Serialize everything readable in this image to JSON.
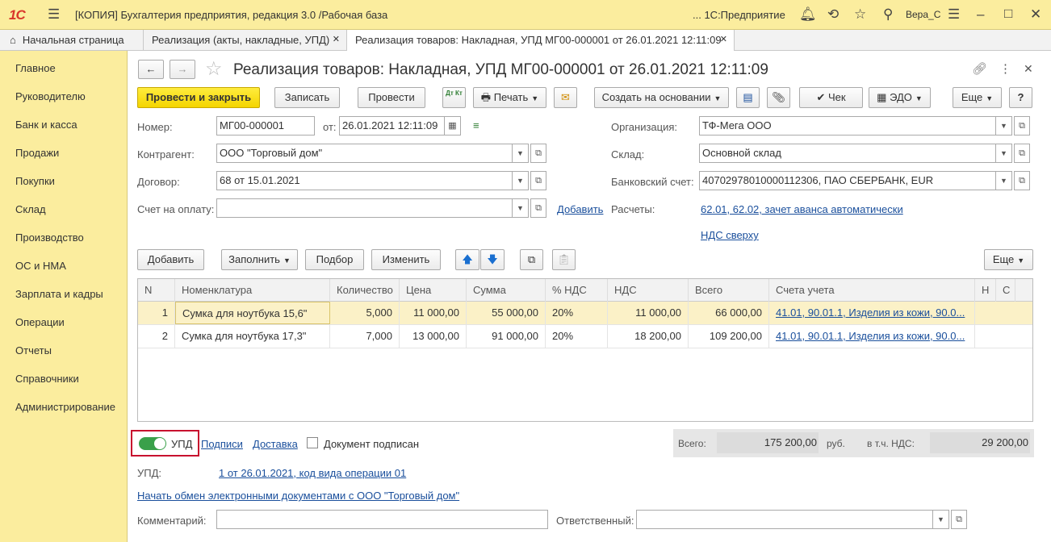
{
  "titlebar": {
    "logo": "1С",
    "title": "[КОПИЯ] Бухгалтерия предприятия, редакция 3.0 /Рабочая база",
    "enterprise": "... 1С:Предприятие",
    "user": "Вера_С"
  },
  "tabs": [
    {
      "label": "Начальная страница"
    },
    {
      "label": "Реализация (акты, накладные, УПД)"
    },
    {
      "label": "Реализация товаров: Накладная, УПД МГ00-000001 от 26.01.2021 12:11:09"
    }
  ],
  "sidebar": {
    "items": [
      "Главное",
      "Руководителю",
      "Банк и касса",
      "Продажи",
      "Покупки",
      "Склад",
      "Производство",
      "ОС и НМА",
      "Зарплата и кадры",
      "Операции",
      "Отчеты",
      "Справочники",
      "Администрирование"
    ]
  },
  "doc": {
    "title": "Реализация товаров: Накладная, УПД МГ00-000001 от 26.01.2021 12:11:09"
  },
  "toolbar": {
    "post_close": "Провести и закрыть",
    "save": "Записать",
    "post": "Провести",
    "dtkt": "Дт Кт",
    "print": "Печать",
    "create_based": "Создать на основании",
    "receipt": "Чек",
    "edo": "ЭДО",
    "more": "Еще",
    "help": "?"
  },
  "form": {
    "number_label": "Номер:",
    "number": "МГ00-000001",
    "date_label": "от:",
    "date": "26.01.2021 12:11:09",
    "org_label": "Организация:",
    "org": "ТФ-Мега ООО",
    "counterparty_label": "Контрагент:",
    "counterparty": "ООО \"Торговый дом\"",
    "warehouse_label": "Склад:",
    "warehouse": "Основной склад",
    "contract_label": "Договор:",
    "contract": "68 от 15.01.2021",
    "bank_label": "Банковский счет:",
    "bank": "40702978010000112306, ПАО СБЕРБАНК, EUR",
    "invoice_label": "Счет на оплату:",
    "invoice": "",
    "add_link": "Добавить",
    "settlements_label": "Расчеты:",
    "settlements_link": "62.01, 62.02, зачет аванса автоматически",
    "vat_link": "НДС сверху"
  },
  "table_toolbar": {
    "add": "Добавить",
    "fill": "Заполнить",
    "select": "Подбор",
    "change": "Изменить",
    "more": "Еще"
  },
  "table": {
    "headers": [
      "N",
      "Номенклатура",
      "Количество",
      "Цена",
      "Сумма",
      "% НДС",
      "НДС",
      "Всего",
      "Счета учета",
      "Н",
      "С"
    ],
    "rows": [
      [
        "1",
        "Сумка для ноутбука 15,6\"",
        "5,000",
        "11 000,00",
        "55 000,00",
        "20%",
        "11 000,00",
        "66 000,00",
        "41.01, 90.01.1, Изделия из кожи, 90.0..."
      ],
      [
        "2",
        "Сумка для ноутбука 17,3\"",
        "7,000",
        "13 000,00",
        "91 000,00",
        "20%",
        "18 200,00",
        "109 200,00",
        "41.01, 90.01.1, Изделия из кожи, 90.0..."
      ]
    ]
  },
  "footer": {
    "upd_toggle": "УПД",
    "signatures": "Подписи",
    "delivery": "Доставка",
    "signed": "Документ подписан",
    "total_label": "Всего:",
    "total": "175 200,00",
    "currency": "руб.",
    "vat_label": "в т.ч. НДС:",
    "vat": "29 200,00",
    "upd_label": "УПД:",
    "upd_link": "1 от 26.01.2021, код вида операции 01",
    "edo_link": "Начать обмен электронными документами с ООО \"Торговый дом\"",
    "comment_label": "Комментарий:",
    "comment": "",
    "responsible_label": "Ответственный:",
    "responsible": ""
  },
  "colors": {
    "sidebar": "#fbed9e",
    "primary_button": "#f4d500",
    "selected_row": "#fbf1c7",
    "link": "#1a4f9c",
    "toggle_on": "#3aa04a",
    "highlight_border": "#c8102e"
  }
}
